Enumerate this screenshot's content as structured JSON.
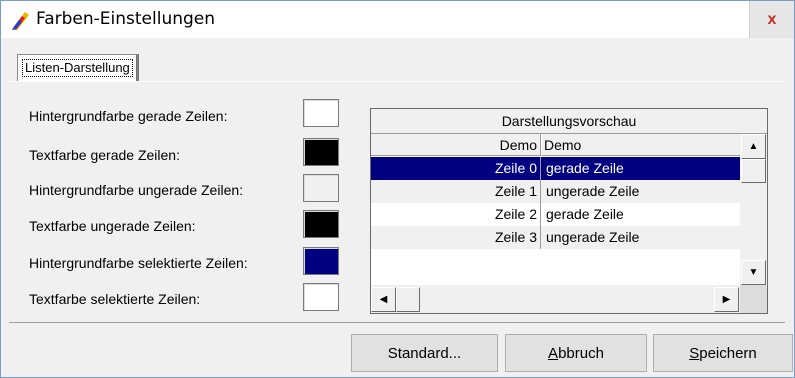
{
  "window": {
    "title": "Farben-Einstellungen",
    "close_label": "x"
  },
  "tabs": [
    {
      "label": "Listen-Darstellung"
    }
  ],
  "settings": [
    {
      "label": "Hintergrundfarbe gerade Zeilen:",
      "color": "#ffffff"
    },
    {
      "label": "Textfarbe gerade Zeilen:",
      "color": "#000000"
    },
    {
      "label": "Hintergrundfarbe ungerade Zeilen:",
      "color": "#f0f0f0"
    },
    {
      "label": "Textfarbe ungerade Zeilen:",
      "color": "#000000"
    },
    {
      "label": "Hintergrundfarbe selektierte Zeilen:",
      "color": "#000080"
    },
    {
      "label": "Textfarbe selektierte Zeilen:",
      "color": "#ffffff"
    }
  ],
  "preview": {
    "title": "Darstellungsvorschau",
    "columns": [
      "Demo",
      "Demo"
    ],
    "rows": [
      {
        "c0": "Zeile 0",
        "c1": "gerade Zeile",
        "state": "selected"
      },
      {
        "c0": "Zeile 1",
        "c1": "ungerade Zeile",
        "state": "odd"
      },
      {
        "c0": "Zeile 2",
        "c1": "gerade Zeile",
        "state": "even"
      },
      {
        "c0": "Zeile 3",
        "c1": "ungerade Zeile",
        "state": "odd"
      }
    ]
  },
  "buttons": {
    "standard": "Standard...",
    "cancel": "Abbruch",
    "save": "Speichern"
  },
  "icons": {
    "app": "color-pencils-icon",
    "scroll_up": "arrow-up-icon",
    "scroll_down": "arrow-down-icon",
    "scroll_left": "arrow-left-icon",
    "scroll_right": "arrow-right-icon"
  }
}
